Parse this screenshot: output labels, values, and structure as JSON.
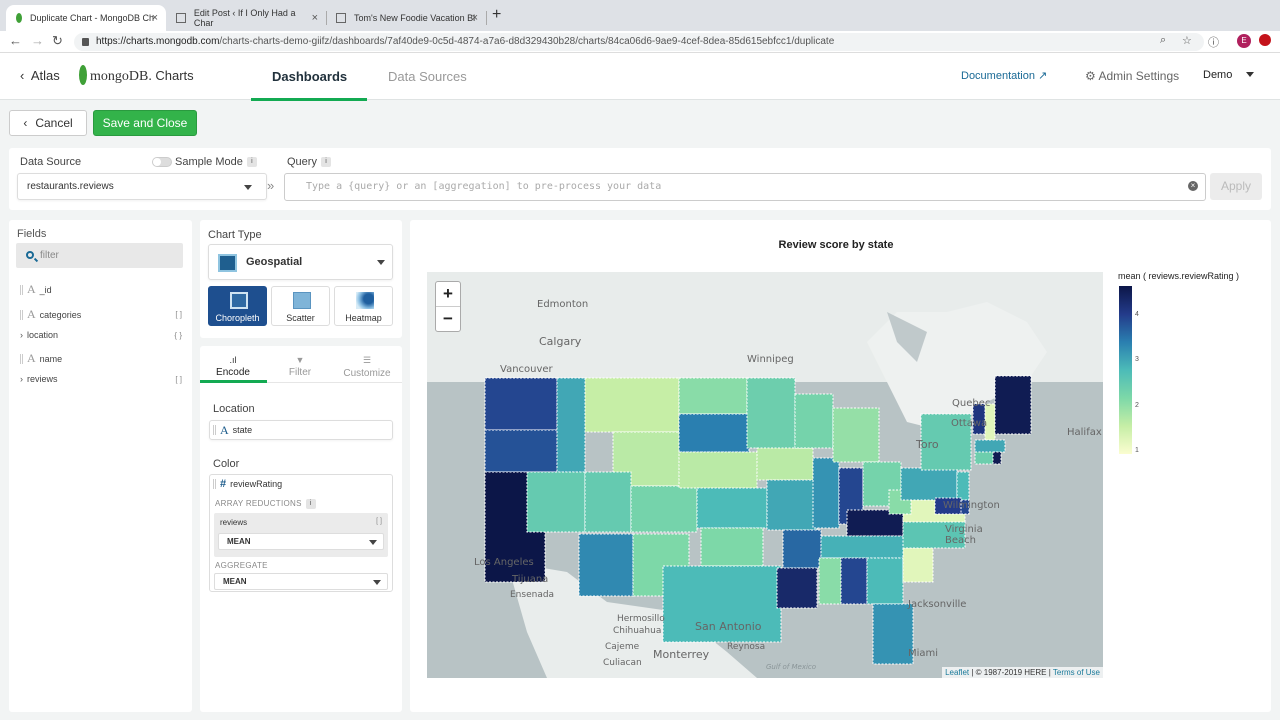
{
  "browser": {
    "tabs": [
      {
        "title": "Duplicate Chart - MongoDB Ch",
        "active": true
      },
      {
        "title": "Edit Post ‹ If I Only Had a Char",
        "active": false
      },
      {
        "title": "Tom's New Foodie Vacation Bl",
        "active": false
      }
    ],
    "url_host": "https://charts.mongodb.com",
    "url_path": "/charts-charts-demo-giifz/dashboards/7af40de9-0c5d-4874-a7a6-d8d329430b28/charts/84ca06d6-9ae9-4cef-8dea-85d615ebfcc1/duplicate",
    "profile_initial": "E"
  },
  "header": {
    "back_label": "Atlas",
    "logo_text": "mongoDB",
    "logo_suffix": "Charts",
    "nav": [
      {
        "label": "Dashboards",
        "active": true
      },
      {
        "label": "Data Sources",
        "active": false
      }
    ],
    "documentation": "Documentation",
    "admin_settings": "Admin Settings",
    "user": "Demo"
  },
  "actions": {
    "cancel": "Cancel",
    "save": "Save and Close"
  },
  "data_source": {
    "label": "Data Source",
    "sample_mode": "Sample Mode",
    "sample_mode_on": false,
    "selected": "restaurants.reviews",
    "query_label": "Query",
    "query_placeholder": "Type a {query} or an [aggregation] to pre-process your data",
    "query_value": "",
    "apply": "Apply",
    "info_glyph": "i"
  },
  "fields": {
    "title": "Fields",
    "filter_placeholder": "filter",
    "items": [
      {
        "name": "_id",
        "type": "string",
        "badge": ""
      },
      {
        "name": "categories",
        "type": "string",
        "badge": "[ ]"
      },
      {
        "name": "location",
        "type": "object",
        "badge": "{ }"
      },
      {
        "name": "name",
        "type": "string",
        "badge": ""
      },
      {
        "name": "reviews",
        "type": "array",
        "badge": "[ ]"
      }
    ]
  },
  "chart_type": {
    "label": "Chart Type",
    "selected": "Geospatial",
    "variants": [
      {
        "label": "Choropleth",
        "active": true
      },
      {
        "label": "Scatter",
        "active": false
      },
      {
        "label": "Heatmap",
        "active": false
      }
    ]
  },
  "encode": {
    "tabs": [
      {
        "label": "Encode",
        "active": true
      },
      {
        "label": "Filter",
        "active": false
      },
      {
        "label": "Customize",
        "active": false
      }
    ],
    "location_label": "Location",
    "location_field": "state",
    "color_label": "Color",
    "color_field": "reviewRating",
    "array_reductions_label": "ARRAY REDUCTIONS",
    "reduction_field": "reviews",
    "reduction_badge": "[ ]",
    "reduction_value": "MEAN",
    "aggregate_label": "AGGREGATE",
    "aggregate_value": "MEAN"
  },
  "chart": {
    "title": "Review score by state",
    "legend_title": "mean ( reviews.reviewRating )",
    "legend_ticks": [
      "4",
      "3",
      "2",
      "1"
    ],
    "zoom_in": "+",
    "zoom_out": "−",
    "attribution_leaflet": "Leaflet",
    "attribution_here": " | © 1987-2019 HERE | ",
    "attribution_terms": "Terms of Use",
    "city_labels": [
      "Edmonton",
      "Calgary",
      "Vancouver",
      "Winnipeg",
      "Quebec",
      "Ottawa",
      "Toro",
      "Halifax",
      "Los Angeles",
      "Tijuana",
      "Ensenada",
      "Hermosillo",
      "Chihuahua",
      "Cajeme",
      "Culiacan",
      "Monterrey",
      "San Antonio",
      "Reynosa",
      "Jacksonville",
      "Miami",
      "Wilmington",
      "Virginia Beach",
      "Gulf of Mexico"
    ]
  },
  "chart_data": {
    "type": "heatmap",
    "title": "Review score by state",
    "legend_title": "mean ( reviews.reviewRating )",
    "color_range": [
      1,
      4.6
    ],
    "legend_ticks": [
      1,
      2,
      3,
      4
    ],
    "colors": {
      "low": "#fbfdd0",
      "mid": "#4cbbb8",
      "high": "#0c1648"
    },
    "values_by_state": {
      "WA": 3.9,
      "OR": 3.8,
      "CA": 4.6,
      "ID": 3.0,
      "NV": 2.5,
      "MT": 1.6,
      "WY": 1.7,
      "UT": 2.5,
      "AZ": 3.3,
      "CO": 2.3,
      "NM": 2.2,
      "ND": 2.1,
      "SD": 3.4,
      "NE": 1.7,
      "KS": 2.8,
      "OK": 2.2,
      "TX": 2.8,
      "MN": 2.4,
      "IA": 1.7,
      "MO": 3.0,
      "AR": 3.6,
      "LA": 4.3,
      "WI": 2.3,
      "IL": 3.2,
      "MI": 2.0,
      "IN": 3.9,
      "OH": 2.3,
      "KY": 4.5,
      "TN": 2.9,
      "MS": 2.1,
      "AL": 3.9,
      "GA": 2.8,
      "FL": 3.2,
      "SC": 1.3,
      "NC": 2.6,
      "VA": 1.3,
      "WV": 2.1,
      "PA": 3.0,
      "NY": 2.5,
      "VT": 4.1,
      "NH": 1.3,
      "ME": 4.5,
      "MA": 3.0,
      "CT": 2.4,
      "RI": 4.5,
      "NJ": 2.8,
      "DE": 3.9,
      "MD": 4.0
    }
  }
}
